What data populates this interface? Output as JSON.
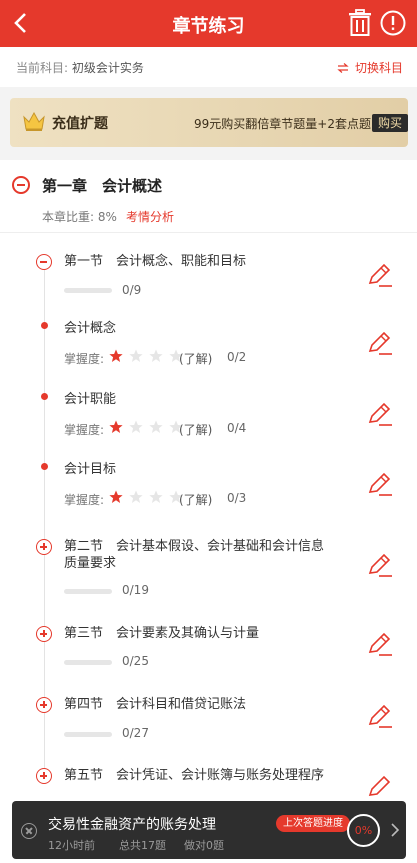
{
  "header": {
    "title": "章节练习"
  },
  "subject": {
    "label": "当前科目:",
    "value": "初级会计实务",
    "switch_label": "切换科目"
  },
  "vip": {
    "title": "充值扩题",
    "desc": "99元购买翻倍章节题量+2套点题",
    "buy_label": "购买"
  },
  "chapter": {
    "title": "第一章　会计概述",
    "weight_text": "本章比重: 8%",
    "analysis_label": "考情分析"
  },
  "sections": [
    {
      "kind": "open",
      "title": "第一节　会计概念、职能和目标",
      "progress": "0/9"
    },
    {
      "kind": "point",
      "title": "会计概念",
      "mastery_label": "掌握度:",
      "stars": 1,
      "stars_max": 4,
      "level": "(了解)",
      "progress": "0/2"
    },
    {
      "kind": "point",
      "title": "会计职能",
      "mastery_label": "掌握度:",
      "stars": 1,
      "stars_max": 4,
      "level": "(了解)",
      "progress": "0/4"
    },
    {
      "kind": "point",
      "title": "会计目标",
      "mastery_label": "掌握度:",
      "stars": 1,
      "stars_max": 4,
      "level": "(了解)",
      "progress": "0/3"
    },
    {
      "kind": "closed",
      "title": "第二节　会计基本假设、会计基础和会计信息质量要求",
      "title_line1": "第二节　会计基本假设、会计基础和会计信息",
      "title_line2": "质量要求",
      "progress": "0/19"
    },
    {
      "kind": "closed",
      "title": "第三节　会计要素及其确认与计量",
      "progress": "0/25"
    },
    {
      "kind": "closed",
      "title": "第四节　会计科目和借贷记账法",
      "progress": "0/27"
    },
    {
      "kind": "closed",
      "title": "第五节　会计凭证、会计账簿与账务处理程序",
      "progress": ""
    }
  ],
  "bottom": {
    "title": "交易性金融资产的账务处理",
    "time": "12小时前",
    "total": "总共17题",
    "done": "做对0题",
    "badge": "上次答题进度",
    "percent": "0%"
  },
  "colors": {
    "accent": "#e5392c",
    "vip_gold": "#e7d6b2",
    "bottom_bg": "#2e2e2e"
  },
  "icons": [
    "back-arrow-icon",
    "trash-icon",
    "alert-icon",
    "switch-icon",
    "crown-icon",
    "star-icon",
    "edit-icon",
    "close-icon",
    "chevron-right-icon"
  ]
}
